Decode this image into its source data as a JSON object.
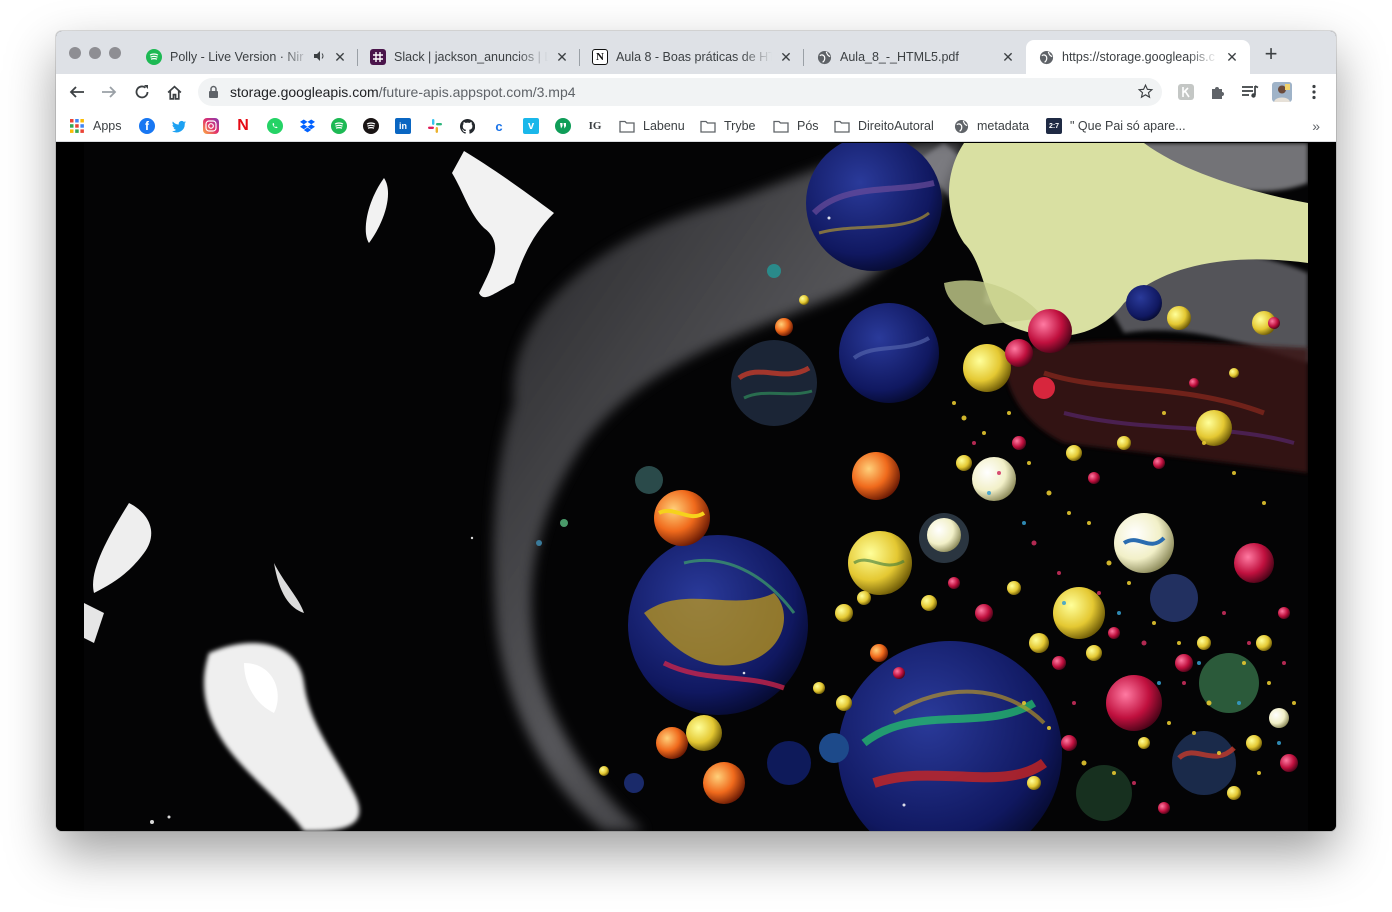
{
  "tabs": [
    {
      "title": "Polly - Live Version · Nir",
      "icon": "spotify-icon",
      "audio": true
    },
    {
      "title": "Slack | jackson_anuncios | L",
      "icon": "slack-icon"
    },
    {
      "title": "Aula 8 - Boas práticas de HT",
      "icon": "notion-icon"
    },
    {
      "title": "Aula_8_-_HTML5.pdf",
      "icon": "globe-icon"
    },
    {
      "title": "https://storage.googleapis.c",
      "icon": "globe-icon",
      "active": true
    }
  ],
  "address": {
    "domain": "storage.googleapis.com",
    "path": "/future-apis.appspot.com/3.mp4"
  },
  "bookmarks": {
    "apps_label": "Apps",
    "folders": [
      {
        "label": "Labenu"
      },
      {
        "label": "Trybe"
      },
      {
        "label": "Pós"
      },
      {
        "label": "DireitoAutoral"
      }
    ],
    "metadata_label": "metadata",
    "last_label": "\" Que Pai só apare...",
    "ig_text": "IG",
    "num_badge": "2:7"
  },
  "colors": {
    "tab_strip": "#dee1e6",
    "spotify": "#1db954",
    "slack": "#4a154b",
    "facebook": "#1877f2",
    "twitter": "#1da1f2",
    "netflix": "#e50914",
    "whatsapp": "#25d366",
    "dropbox": "#0061ff",
    "linkedin": "#0a66c2",
    "vimeo": "#1ab7ea"
  }
}
